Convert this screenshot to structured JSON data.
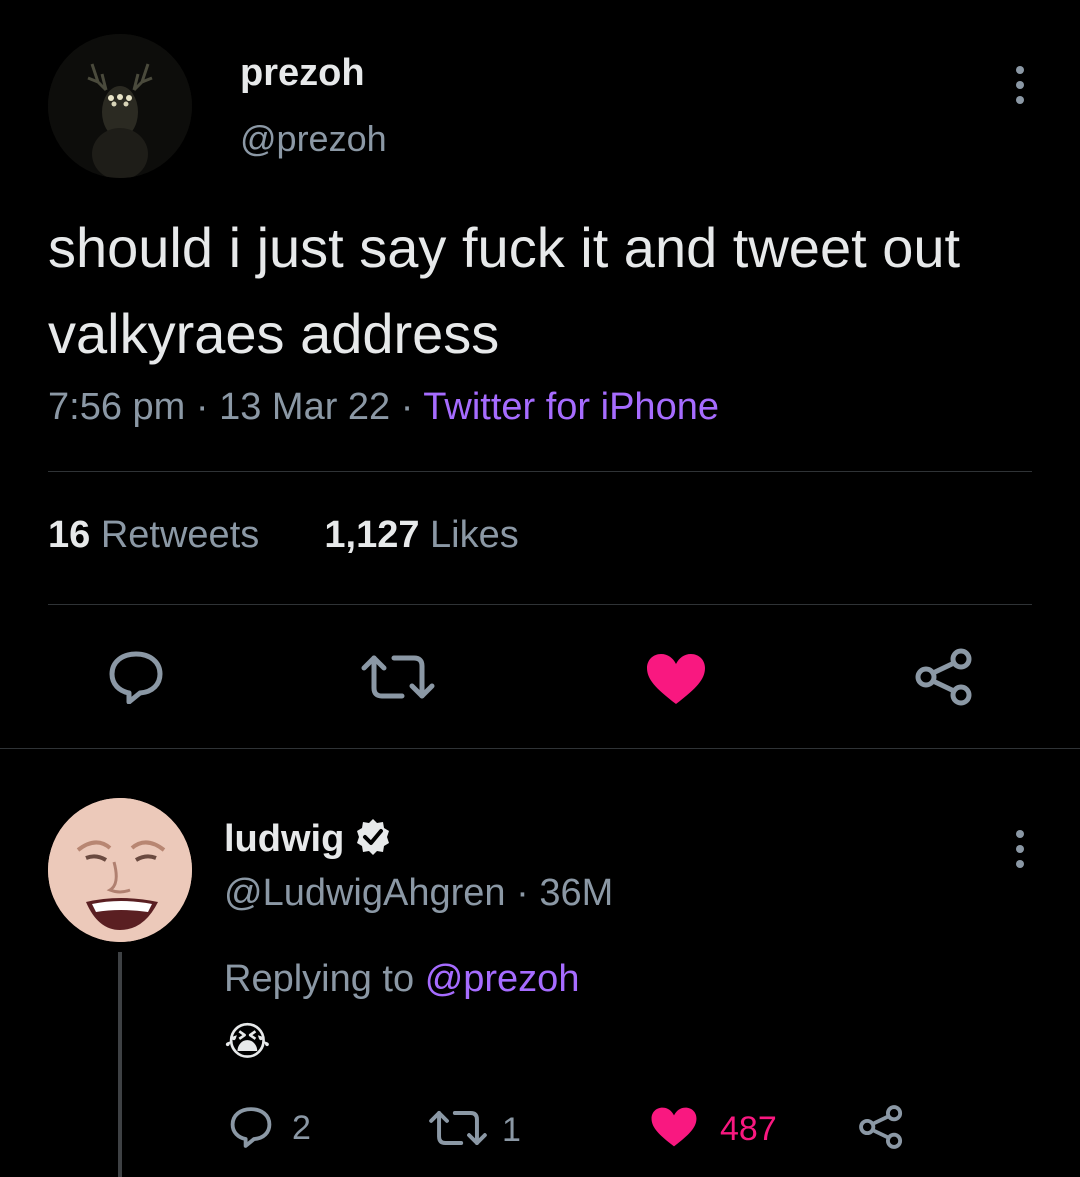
{
  "tweet": {
    "author": {
      "name": "prezoh",
      "handle": "@prezoh"
    },
    "text": "should i just say fuck it and tweet out valkyraes address",
    "time": "7:56 pm",
    "date": "13 Mar 22",
    "source": "Twitter for iPhone",
    "separator": " · ",
    "retweets_count": "16",
    "retweets_label": "Retweets",
    "likes_count": "1,127",
    "likes_label": "Likes",
    "liked": true
  },
  "reply": {
    "author": {
      "name": "ludwig",
      "handle": "@LudwigAhgren",
      "verified": true
    },
    "age": "36M",
    "handle_separator": " · ",
    "replying_prefix": "Replying to",
    "replying_to": "@prezoh",
    "text": "😭",
    "reply_count": "2",
    "retweet_count": "1",
    "like_count": "487",
    "liked": true
  },
  "colors": {
    "background": "#000000",
    "text_primary": "#e7e9ea",
    "text_secondary": "#8b98a5",
    "accent_link": "#a66cff",
    "like_pink": "#f91880",
    "divider": "#2f3336"
  },
  "icons": [
    "more-icon",
    "reply-icon",
    "retweet-icon",
    "like-icon",
    "share-icon",
    "verified-badge-icon"
  ]
}
